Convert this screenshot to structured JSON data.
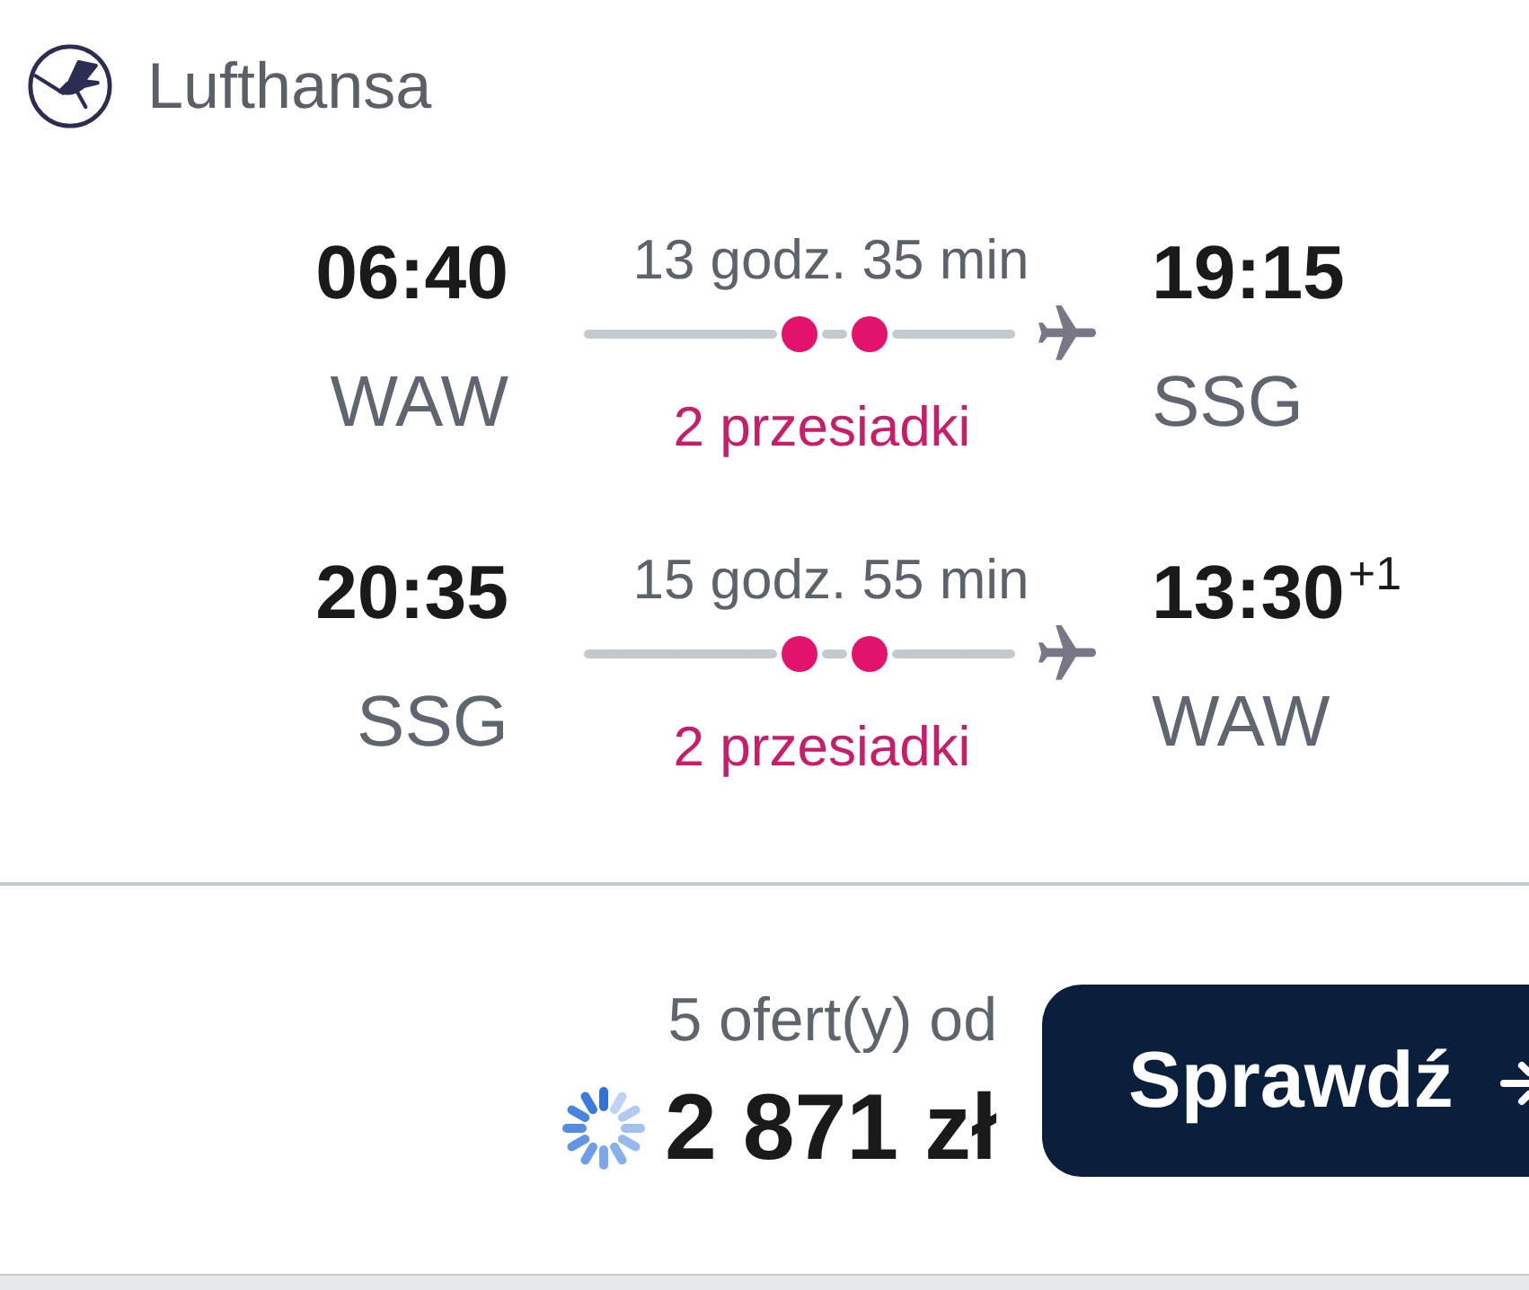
{
  "airline": {
    "name": "Lufthansa"
  },
  "legs": [
    {
      "departure": {
        "time": "06:40",
        "airport": "WAW"
      },
      "duration": "13 godz. 35 min",
      "stops": [
        {
          "kind": "layover"
        },
        {
          "kind": "layover"
        }
      ],
      "stops_label": "2 przesiadki",
      "arrival": {
        "time": "19:15",
        "airport": "SSG"
      }
    },
    {
      "departure": {
        "time": "20:35",
        "airport": "SSG"
      },
      "duration": "15 godz. 55 min",
      "stops": [
        {
          "kind": "layover"
        },
        {
          "kind": "layover"
        }
      ],
      "stops_label": "2 przesiadki",
      "arrival": {
        "time": "13:30",
        "day_offset": "+1",
        "airport": "WAW"
      }
    }
  ],
  "offer": {
    "count_label": "5 ofert(y) od",
    "loading": true,
    "price": "2 871 zł",
    "button": {
      "label": "Sprawdź"
    }
  }
}
